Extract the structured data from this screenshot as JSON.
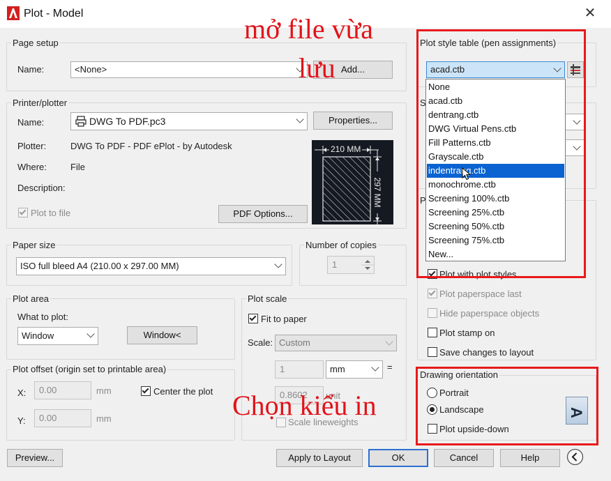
{
  "window": {
    "title": "Plot - Model",
    "close_symbol": "✕"
  },
  "overlay": {
    "top_text_line1": "mở file vừa",
    "top_text_line2": "lưu",
    "bottom_text": "Chọn kiểu in"
  },
  "page_setup": {
    "group_label": "Page setup",
    "name_label": "Name:",
    "name_value": "<None>",
    "add_button": "Add..."
  },
  "printer": {
    "group_label": "Printer/plotter",
    "name_label": "Name:",
    "name_value": "DWG To PDF.pc3",
    "properties_button": "Properties...",
    "plotter_label": "Plotter:",
    "plotter_value": "DWG To PDF - PDF ePlot - by Autodesk",
    "where_label": "Where:",
    "where_value": "File",
    "description_label": "Description:",
    "plot_to_file_label": "Plot to file",
    "plot_to_file_checked": true,
    "pdf_options_button": "PDF Options...",
    "preview_width": "210 MM",
    "preview_height": "297 MM"
  },
  "paper_size": {
    "group_label": "Paper size",
    "value": "ISO full bleed A4 (210.00 x 297.00 MM)"
  },
  "copies": {
    "group_label": "Number of copies",
    "value": "1"
  },
  "plot_area": {
    "group_label": "Plot area",
    "what_label": "What to plot:",
    "what_value": "Window",
    "window_button": "Window<"
  },
  "plot_offset": {
    "group_label": "Plot offset (origin set to printable area)",
    "x_label": "X:",
    "x_value": "0.00",
    "x_unit": "mm",
    "y_label": "Y:",
    "y_value": "0.00",
    "y_unit": "mm",
    "center_label": "Center the plot",
    "center_checked": true
  },
  "plot_scale": {
    "group_label": "Plot scale",
    "fit_label": "Fit to paper",
    "fit_checked": true,
    "scale_label": "Scale:",
    "scale_value": "Custom",
    "value1": "1",
    "unit1": "mm",
    "equals": "=",
    "value2": "0.8602",
    "unit2": "unit",
    "lineweights_label": "Scale lineweights"
  },
  "plot_style_table": {
    "group_label": "Plot style table (pen assignments)",
    "value": "acad.ctb",
    "options": [
      "None",
      "acad.ctb",
      "dentrang.ctb",
      "DWG Virtual Pens.ctb",
      "Fill Patterns.ctb",
      "Grayscale.ctb",
      "indentrang.ctb",
      "monochrome.ctb",
      "Screening 100%.ctb",
      "Screening 25%.ctb",
      "Screening 50%.ctb",
      "Screening 75%.ctb",
      "New..."
    ],
    "highlighted_index": 6
  },
  "plot_options": {
    "partial_s": "S",
    "partial_p": "P",
    "plot_with_styles": "Plot with plot styles",
    "plot_paperspace_last": "Plot paperspace last",
    "hide_paperspace": "Hide paperspace objects",
    "plot_stamp": "Plot stamp on",
    "save_changes": "Save changes to layout"
  },
  "orientation": {
    "group_label": "Drawing orientation",
    "portrait": "Portrait",
    "landscape": "Landscape",
    "upside_down": "Plot upside-down",
    "selected": "Landscape",
    "icon_letter": "A"
  },
  "footer": {
    "preview_button": "Preview...",
    "apply_button": "Apply to Layout",
    "ok_button": "OK",
    "cancel_button": "Cancel",
    "help_button": "Help"
  },
  "colors": {
    "accent": "#0a63d1",
    "annotation_red": "#e8191c",
    "autocad_red": "#d31f1f"
  }
}
